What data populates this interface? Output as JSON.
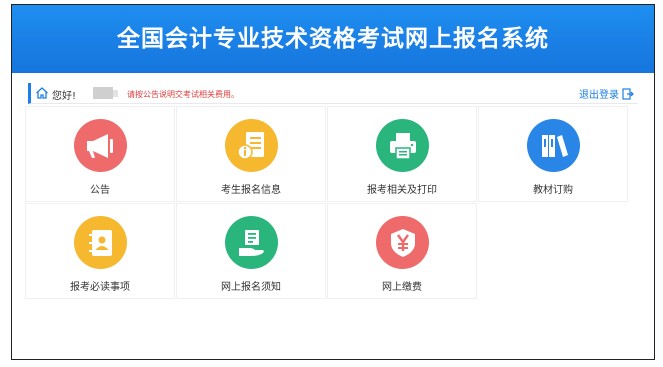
{
  "header": {
    "title": "全国会计专业技术资格考试网上报名系统"
  },
  "userbar": {
    "greeting": "您好!",
    "notice": "请按公告说明交考试相关费用。",
    "logout_label": "退出登录"
  },
  "tiles": [
    {
      "label": "公告",
      "icon": "megaphone-icon",
      "color": "#ef6a6a"
    },
    {
      "label": "考生报名信息",
      "icon": "info-document-icon",
      "color": "#f5b82e"
    },
    {
      "label": "报考相关及打印",
      "icon": "printer-icon",
      "color": "#2ab57d"
    },
    {
      "label": "教材订购",
      "icon": "books-icon",
      "color": "#2a86e6"
    },
    {
      "label": "报考必读事项",
      "icon": "contact-book-icon",
      "color": "#f5b82e"
    },
    {
      "label": "网上报名须知",
      "icon": "hand-document-icon",
      "color": "#2ab57d"
    },
    {
      "label": "网上缴费",
      "icon": "yen-shield-icon",
      "color": "#ef6a6a"
    }
  ],
  "colors": {
    "banner": "#1a7fe6",
    "notice": "#e03b3b",
    "accent": "#1a7fe6"
  }
}
